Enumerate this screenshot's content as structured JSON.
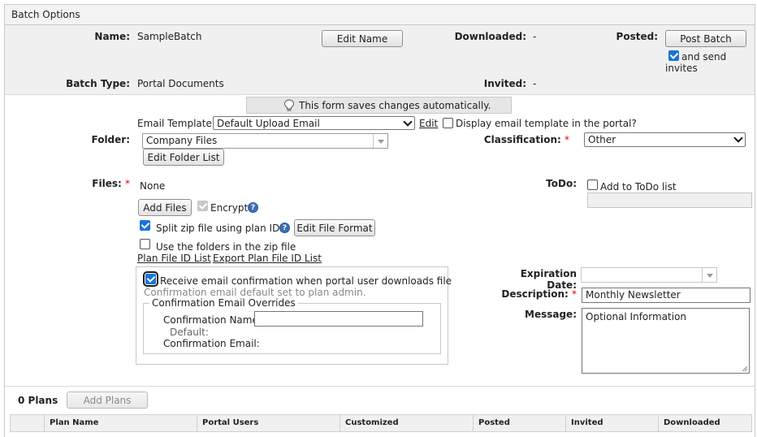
{
  "header": {
    "title": "Batch Options"
  },
  "summary": {
    "name_label": "Name:",
    "name_value": "SampleBatch",
    "edit_name": "Edit Name",
    "downloaded_label": "Downloaded:",
    "downloaded_value": "-",
    "posted_label": "Posted:",
    "post_batch": "Post Batch",
    "send_invites_line1": "and send",
    "send_invites_line2": "invites",
    "batch_type_label": "Batch Type:",
    "batch_type_value": "Portal Documents",
    "invited_label": "Invited:",
    "invited_value": "-"
  },
  "notice": "This form saves changes automatically.",
  "email_template": {
    "label": "Email Template:",
    "value": "Default Upload Email",
    "edit_link": "Edit",
    "display_label": "Display email template in the portal?"
  },
  "folder": {
    "label": "Folder:",
    "value": "Company Files",
    "edit_button": "Edit Folder List"
  },
  "classification": {
    "label": "Classification:",
    "value": "Other"
  },
  "files": {
    "label": "Files:",
    "value": "None",
    "add_files": "Add Files",
    "encrypt": "Encrypt",
    "split_zip": "Split zip file using plan IDs",
    "edit_file_format": "Edit File Format",
    "use_folders": "Use the folders in the zip file",
    "plan_file_id_list": "Plan File ID List",
    "export_plan_file_id_list": "Export Plan File ID List"
  },
  "todo": {
    "label": "ToDo:",
    "add_label": "Add to ToDo list"
  },
  "confirmation": {
    "receive": "Receive email confirmation when portal user downloads file",
    "default_note": "Confirmation email default set to plan admin.",
    "overrides_legend": "Confirmation Email Overrides",
    "name_label": "Confirmation Name:",
    "default_label": "Default:",
    "email_label": "Confirmation Email:"
  },
  "expiration": {
    "label": "Expiration Date:"
  },
  "description": {
    "label": "Description:",
    "value": "Monthly Newsletter"
  },
  "message": {
    "label": "Message:",
    "value": "Optional Information"
  },
  "plans": {
    "count": "0 Plans",
    "add_plans": "Add Plans",
    "columns": [
      "Plan Name",
      "Portal Users",
      "Customized",
      "Posted",
      "Invited",
      "Downloaded"
    ]
  },
  "icons": {
    "notice": "lightbulb-icon",
    "help": "help-icon"
  }
}
